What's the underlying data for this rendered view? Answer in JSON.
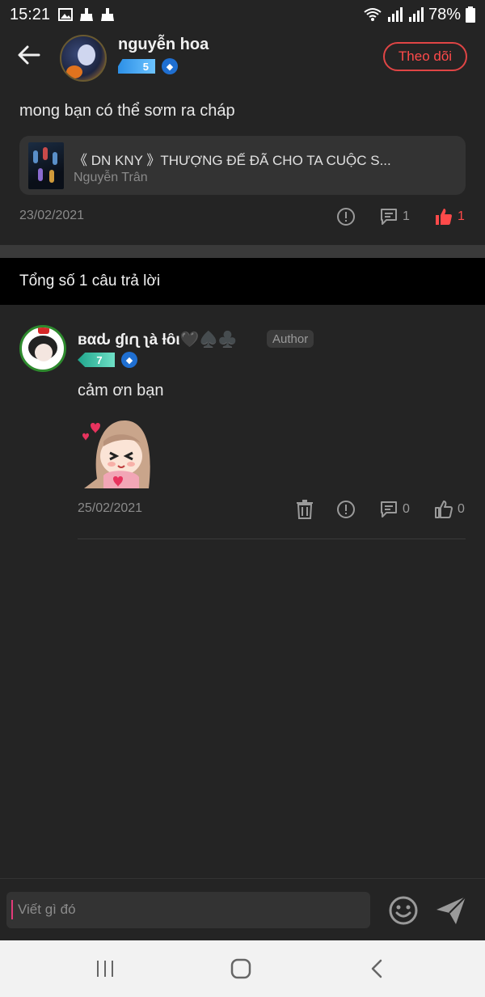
{
  "status": {
    "time": "15:21",
    "battery": "78%"
  },
  "header": {
    "author_name": "nguyễn hoa",
    "level": "5",
    "follow_label": "Theo dõi"
  },
  "post": {
    "question": "mong bạn có thể sơm ra cháp",
    "book": {
      "title": "《 DN KNY 》THƯỢNG ĐẾ ĐÃ CHO TA CUỘC S...",
      "author": "Nguyễn Trân"
    },
    "date": "23/02/2021",
    "comment_count": "1",
    "like_count": "1",
    "colors": {
      "liked": "#ff4a4a"
    }
  },
  "replies_header": "Tổng số 1 câu trả lời",
  "reply": {
    "name": "вαԃ ɠιɾʅ ʅà ƚȏι🖤♠️♣️",
    "tag": "Author",
    "level": "7",
    "text": "cảm ơn bạn",
    "date": "25/02/2021",
    "comment_count": "0",
    "like_count": "0"
  },
  "composer": {
    "placeholder": "Viết gì đó"
  },
  "icons": [
    "back-arrow-icon",
    "report-icon",
    "comment-icon",
    "like-icon",
    "delete-icon",
    "emoji-icon",
    "send-icon",
    "recents-icon",
    "home-icon",
    "back-nav-icon"
  ]
}
